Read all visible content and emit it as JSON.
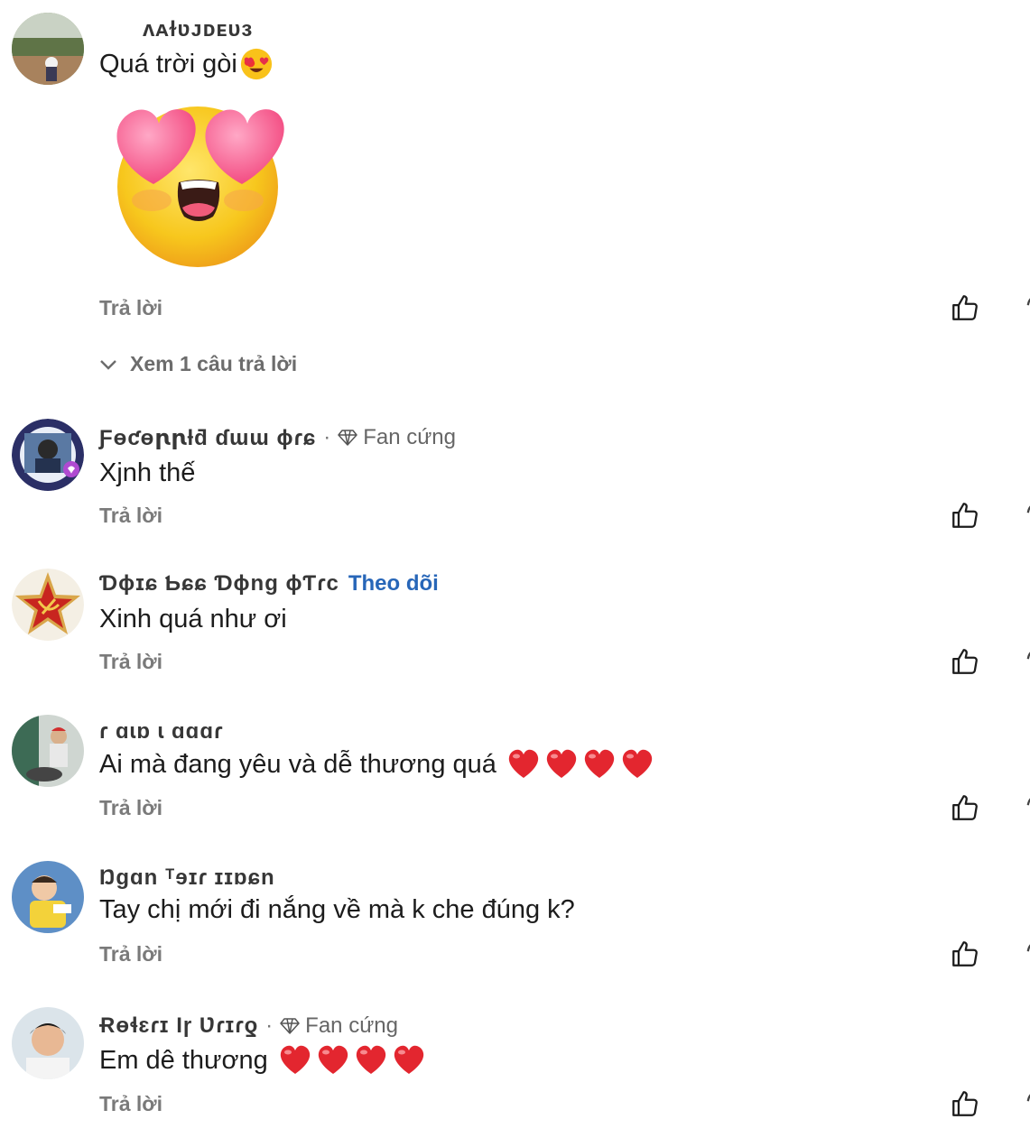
{
  "reply_label": "Trả lời",
  "view_replies_label": "Xem 1 câu trả lời",
  "colors": {
    "follow": "#2766b8",
    "muted": "#7a7a7a",
    "heart": "#e3262f"
  },
  "comments": [
    {
      "author": "ᴧᴀɫʋᴊᴅᴇᴜɜ",
      "text": "Quá trời gòi",
      "emoji": "heart-eyes-face"
    },
    {
      "author": "Ƒɵƈɵꞃꞃƚƌ ɗɯɯ ɸɾɕ",
      "badge": "Fan cứng",
      "text": "Xjnh thế"
    },
    {
      "author": "Ɗɸɪɕ Ƅɕɕ Ɗɸng ɸƬɾc",
      "follow": "Theo dõi",
      "text": "Xinh quá như ơi"
    },
    {
      "author": "ɾ ɑɩɒ ɩ ɑɑɑɾ",
      "text": "Ai mà đang yêu và dễ thương quá",
      "hearts": 4
    },
    {
      "author": "Ŋɡɑn ᵀɘɪɾ ɪɪɒɕn",
      "text": "Tay chị mới đi nắng về mà k che đúng k?"
    },
    {
      "author": "Ɍɵɬɛɾɪ Ɩɼ Ʋɾɪɾƍ",
      "badge": "Fan cứng",
      "text": "Em dê thương",
      "hearts": 4
    }
  ]
}
